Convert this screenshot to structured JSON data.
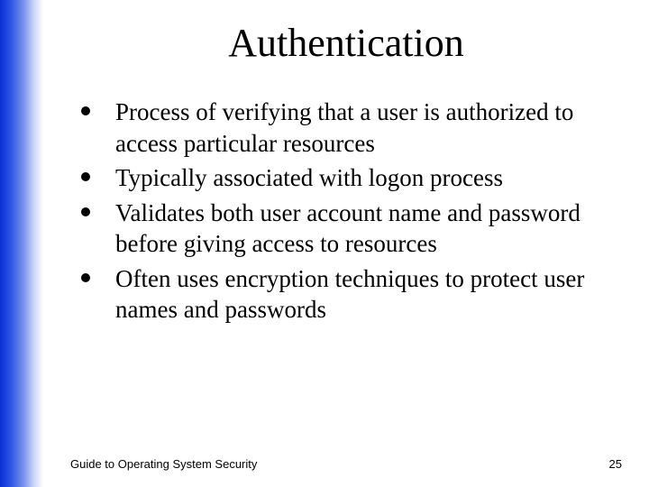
{
  "title": "Authentication",
  "bullets": [
    "Process of verifying that a user is authorized to access particular resources",
    "Typically associated with logon process",
    "Validates both user account name and password before giving access to resources",
    "Often uses encryption techniques to protect user names and passwords"
  ],
  "footer": {
    "left": "Guide to Operating System Security",
    "right": "25"
  }
}
